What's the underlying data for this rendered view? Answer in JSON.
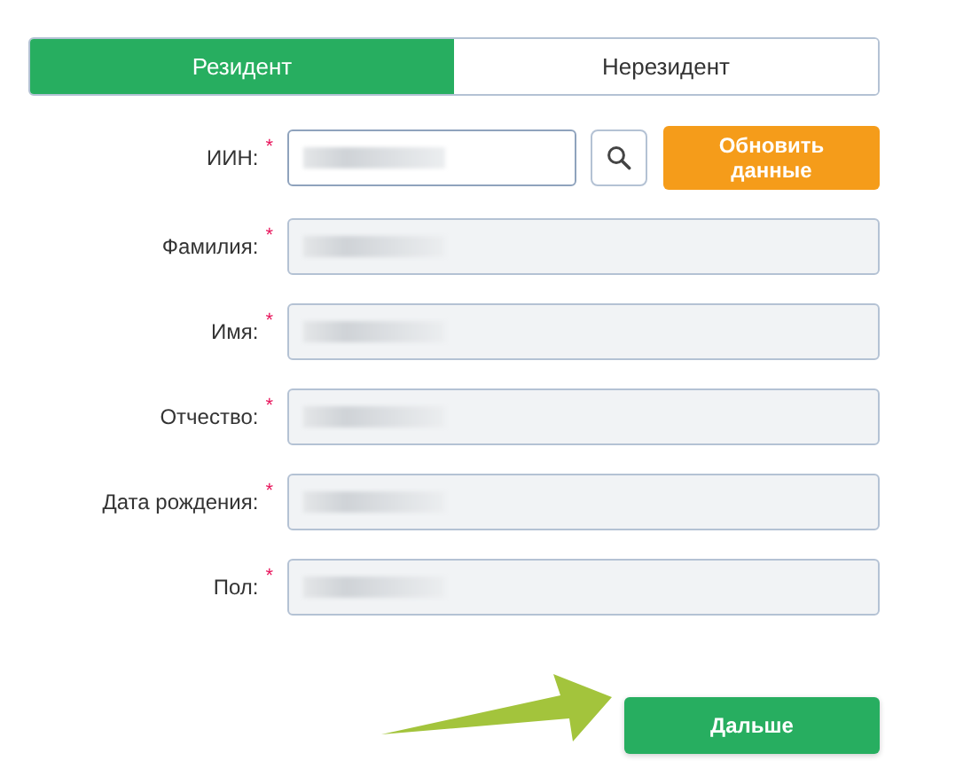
{
  "tabs": [
    {
      "label": "Резидент",
      "selected": true
    },
    {
      "label": "Нерезидент",
      "selected": false
    }
  ],
  "fields": [
    {
      "label": "ИИН:",
      "required_mark": "*",
      "readonly": false,
      "redacted": true,
      "kind": "search"
    },
    {
      "label": "Фамилия:",
      "required_mark": "*",
      "readonly": true,
      "redacted": true,
      "kind": "text"
    },
    {
      "label": "Имя:",
      "required_mark": "*",
      "readonly": true,
      "redacted": true,
      "kind": "text"
    },
    {
      "label": "Отчество:",
      "required_mark": "*",
      "readonly": true,
      "redacted": true,
      "kind": "text"
    },
    {
      "label": "Дата рождения:",
      "required_mark": "*",
      "readonly": true,
      "redacted": true,
      "kind": "text"
    },
    {
      "label": "Пол:",
      "required_mark": "*",
      "readonly": true,
      "redacted": true,
      "kind": "text"
    }
  ],
  "refresh_button": "Обновить данные",
  "next_button": "Дальше",
  "annotation": {
    "kind": "arrow"
  }
}
